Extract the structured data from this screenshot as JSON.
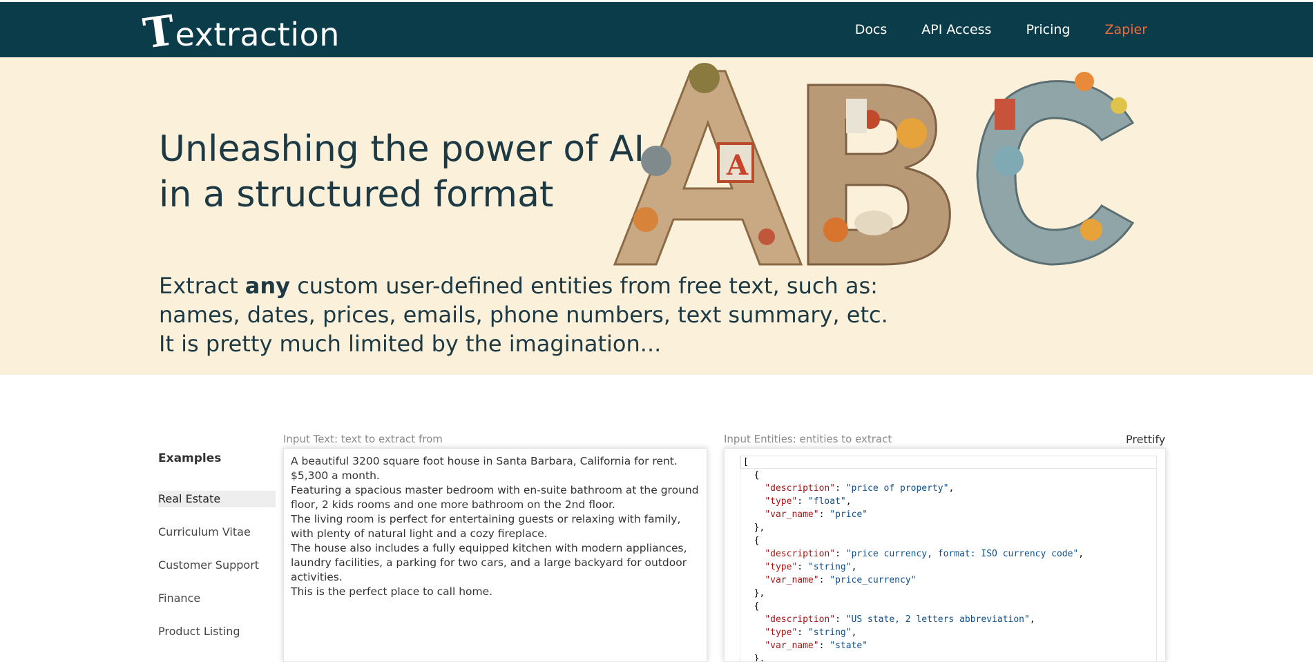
{
  "nav": {
    "logo_first": "T",
    "logo_rest": "extraction",
    "links": [
      "Docs",
      "API Access",
      "Pricing",
      "Zapier"
    ],
    "accent_color": "#f26a3d",
    "bg_color": "#0b3c49"
  },
  "hero": {
    "title_line1": "Unleashing the power of AI",
    "title_line2": "in a structured format",
    "desc_pre": "Extract ",
    "desc_bold": "any",
    "desc_post": " custom user-defined entities from free text, such as:",
    "desc_line2": "names, dates, prices, emails, phone numbers, text summary, etc.",
    "desc_line3": "It is pretty much limited by the imagination...",
    "art_letters": [
      "A",
      "B",
      "C"
    ],
    "bg_color": "#fbf0da"
  },
  "examples": {
    "title": "Examples",
    "items": [
      "Real Estate",
      "Curriculum Vitae",
      "Customer Support",
      "Finance",
      "Product Listing"
    ],
    "active": "Real Estate"
  },
  "input_text": {
    "label": "Input Text: text to extract from",
    "value": "A beautiful 3200 square foot house in Santa Barbara, California for rent.\n$5,300 a month.\nFeaturing a spacious master bedroom with en-suite bathroom at the ground floor, 2 kids rooms and one more bathroom on the 2nd floor.\nThe living room is perfect for entertaining guests or relaxing with family, with plenty of natural light and a cozy fireplace.\nThe house also includes a fully equipped kitchen with modern appliances, laundry facilities, a parking for two cars, and a large backyard for outdoor activities.\nThis is the perfect place to call home."
  },
  "input_entities": {
    "label": "Input Entities: entities to extract",
    "prettify_label": "Prettify",
    "lines": [
      {
        "indent": 0,
        "text": "["
      },
      {
        "indent": 1,
        "text": "{"
      },
      {
        "indent": 2,
        "key": "description",
        "value": "price of property",
        "comma": true
      },
      {
        "indent": 2,
        "key": "type",
        "value": "float",
        "comma": true
      },
      {
        "indent": 2,
        "key": "var_name",
        "value": "price",
        "comma": false
      },
      {
        "indent": 1,
        "text": "},"
      },
      {
        "indent": 1,
        "text": "{"
      },
      {
        "indent": 2,
        "key": "description",
        "value": "price currency, format: ISO currency code",
        "comma": true
      },
      {
        "indent": 2,
        "key": "type",
        "value": "string",
        "comma": true
      },
      {
        "indent": 2,
        "key": "var_name",
        "value": "price_currency",
        "comma": false
      },
      {
        "indent": 1,
        "text": "},"
      },
      {
        "indent": 1,
        "text": "{"
      },
      {
        "indent": 2,
        "key": "description",
        "value": "US state, 2 letters abbreviation",
        "comma": true
      },
      {
        "indent": 2,
        "key": "type",
        "value": "string",
        "comma": true
      },
      {
        "indent": 2,
        "key": "var_name",
        "value": "state",
        "comma": false
      },
      {
        "indent": 1,
        "text": "},"
      }
    ]
  }
}
